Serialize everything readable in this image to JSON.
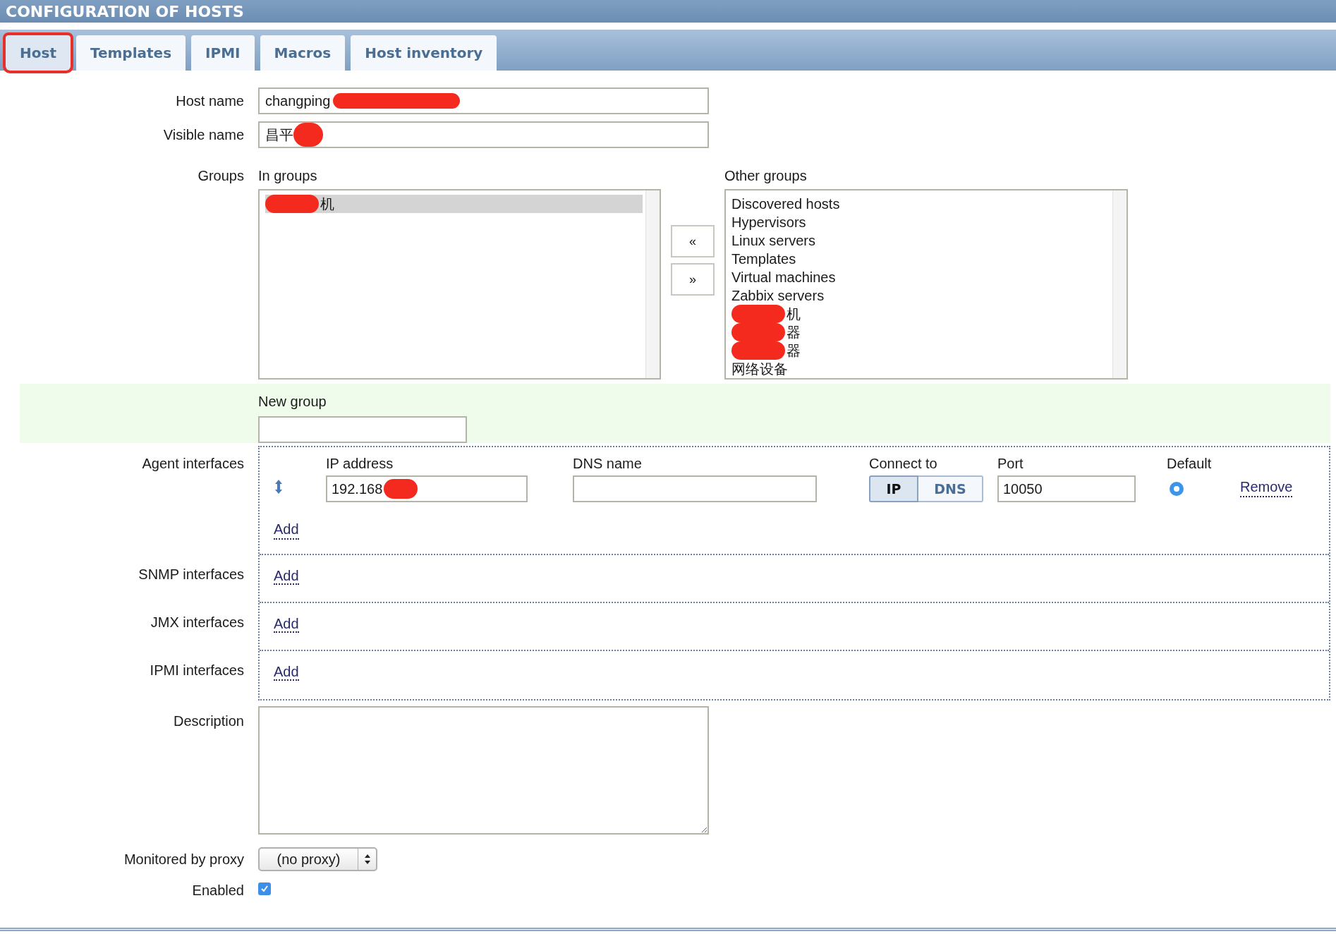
{
  "header": {
    "title": "CONFIGURATION OF HOSTS"
  },
  "tabs": [
    {
      "label": "Host",
      "selected": true,
      "highlighted": true
    },
    {
      "label": "Templates",
      "selected": false,
      "highlighted": false
    },
    {
      "label": "IPMI",
      "selected": false,
      "highlighted": false
    },
    {
      "label": "Macros",
      "selected": false,
      "highlighted": false
    },
    {
      "label": "Host inventory",
      "selected": false,
      "highlighted": false
    }
  ],
  "host_name": {
    "label": "Host name",
    "value": "changping",
    "redacted": true
  },
  "visible_name": {
    "label": "Visible name",
    "value": "昌平",
    "redacted": true
  },
  "groups": {
    "label": "Groups",
    "in_groups_label": "In groups",
    "other_groups_label": "Other groups",
    "in_groups": [
      {
        "text": "机",
        "redacted": true,
        "selected": true
      }
    ],
    "move_buttons": [
      "«",
      "»"
    ],
    "other_groups": [
      {
        "text": "Discovered hosts",
        "redacted": false,
        "selected": false
      },
      {
        "text": "Hypervisors",
        "redacted": false,
        "selected": false
      },
      {
        "text": "Linux servers",
        "redacted": false,
        "selected": false
      },
      {
        "text": "Templates",
        "redacted": false,
        "selected": false
      },
      {
        "text": "Virtual machines",
        "redacted": false,
        "selected": false
      },
      {
        "text": "Zabbix servers",
        "redacted": false,
        "selected": false
      },
      {
        "text": "机",
        "redacted": true,
        "selected": false
      },
      {
        "text": "器",
        "redacted": true,
        "selected": false
      },
      {
        "text": "器",
        "redacted": true,
        "selected": false
      },
      {
        "text": "网络设备",
        "redacted": false,
        "selected": false
      }
    ]
  },
  "new_group": {
    "label": "New group"
  },
  "agent_interfaces": {
    "label": "Agent interfaces",
    "columns": [
      "IP address",
      "DNS name",
      "Connect to",
      "Port",
      "Default"
    ],
    "rows": [
      {
        "ip": "192.168",
        "ip_redacted": true,
        "connect_options": [
          {
            "label": "IP",
            "selected": true
          },
          {
            "label": "DNS",
            "selected": false
          }
        ],
        "port": "10050",
        "default": true,
        "remove": "Remove"
      }
    ],
    "add": "Add"
  },
  "other_interfaces": [
    {
      "label": "SNMP interfaces",
      "add": "Add"
    },
    {
      "label": "JMX interfaces",
      "add": "Add"
    },
    {
      "label": "IPMI interfaces",
      "add": "Add"
    }
  ],
  "description": {
    "label": "Description"
  },
  "proxy": {
    "label": "Monitored by proxy",
    "value": "(no proxy)"
  },
  "enabled": {
    "label": "Enabled",
    "checked": true
  }
}
